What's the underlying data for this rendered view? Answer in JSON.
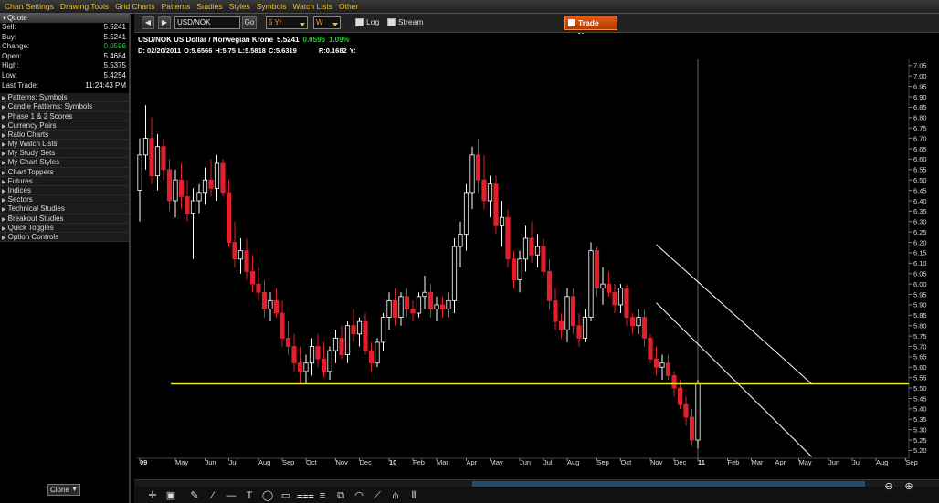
{
  "menubar": {
    "items": [
      "Chart Settings",
      "Drawing Tools",
      "Grid Charts",
      "Patterns",
      "Studies",
      "Styles",
      "Symbols",
      "Watch Lists",
      "Other"
    ]
  },
  "quote": {
    "header": "Quote",
    "rows": [
      {
        "label": "Sell:",
        "value": "5.5241"
      },
      {
        "label": "Buy:",
        "value": "5.5241"
      },
      {
        "label": "Change:",
        "value": "0.0596"
      },
      {
        "label": "Open:",
        "value": "5.4684"
      },
      {
        "label": "High:",
        "value": "5.5375"
      },
      {
        "label": "Low:",
        "value": "5.4254"
      },
      {
        "label": "Last Trade:",
        "value": "11:24:43 PM"
      }
    ]
  },
  "nav": {
    "items": [
      "Patterns: Symbols",
      "Candle Patterns: Symbols",
      "Phase 1 & 2 Scores",
      "Currency Pairs",
      "Ratio Charts",
      "My Watch Lists",
      "My Study Sets",
      "My Chart Styles",
      "Chart Toppers",
      "Futures",
      "Indices",
      "Sectors",
      "Technical Studies",
      "Breakout Studies",
      "Quick Toggles",
      "Option Controls"
    ]
  },
  "clone_label": "Clone",
  "toolbar": {
    "back": "◀",
    "forward": "▶",
    "symbol": "USD/NOK",
    "go": "Go",
    "period": "5 Yr",
    "interval": "W",
    "log_label": "Log",
    "stream_label": "Stream",
    "trade_now": "Trade Now"
  },
  "colors": {
    "up_candle": "#ffffff",
    "down_candle": "#e0202a",
    "support_line": "#e8e81a",
    "channel": "#ffffff",
    "positive": "#2ecc40"
  },
  "chart_data": {
    "type": "candlestick",
    "title": "USD/NOK US Dollar / Norwegian Krone",
    "last": "5.5241",
    "change": "0.0596",
    "change_pct": "1.09%",
    "ohlc_line": {
      "date": "D: 02/20/2011",
      "open": "O:5.6566",
      "high": "H:5.75",
      "low": "L:5.5818",
      "close": "C:5.6319",
      "r": "R:0.1682",
      "y": "Y:"
    },
    "ylim": [
      5.18,
      7.08
    ],
    "y_ticks": [
      "7.05",
      "7.00",
      "6.95",
      "6.90",
      "6.85",
      "6.80",
      "6.75",
      "6.70",
      "6.65",
      "6.60",
      "6.55",
      "6.50",
      "6.45",
      "6.40",
      "6.35",
      "6.30",
      "6.25",
      "6.20",
      "6.15",
      "6.10",
      "6.05",
      "6.00",
      "5.95",
      "5.90",
      "5.85",
      "5.80",
      "5.75",
      "5.70",
      "5.65",
      "5.60",
      "5.55",
      "5.50",
      "5.45",
      "5.40",
      "5.35",
      "5.30",
      "5.25",
      "5.20"
    ],
    "x_ticks": [
      {
        "label": "09",
        "i": 0,
        "bold": true
      },
      {
        "label": "May",
        "i": 6
      },
      {
        "label": "Jun",
        "i": 11
      },
      {
        "label": "Jul",
        "i": 15
      },
      {
        "label": "Aug",
        "i": 20
      },
      {
        "label": "Sep",
        "i": 24
      },
      {
        "label": "Oct",
        "i": 28
      },
      {
        "label": "Nov",
        "i": 33
      },
      {
        "label": "Dec",
        "i": 37
      },
      {
        "label": "10",
        "i": 42,
        "bold": true
      },
      {
        "label": "Feb",
        "i": 46
      },
      {
        "label": "Mar",
        "i": 50
      },
      {
        "label": "Apr",
        "i": 55
      },
      {
        "label": "May",
        "i": 59
      },
      {
        "label": "Jun",
        "i": 64
      },
      {
        "label": "Jul",
        "i": 68
      },
      {
        "label": "Aug",
        "i": 72
      },
      {
        "label": "Sep",
        "i": 77
      },
      {
        "label": "Oct",
        "i": 81
      },
      {
        "label": "Nov",
        "i": 86
      },
      {
        "label": "Dec",
        "i": 90
      },
      {
        "label": "11",
        "i": 94,
        "bold": true
      },
      {
        "label": "Feb",
        "i": 99
      },
      {
        "label": "Mar",
        "i": 103
      },
      {
        "label": "Apr",
        "i": 107
      },
      {
        "label": "May",
        "i": 111
      },
      {
        "label": "Jun",
        "i": 116
      },
      {
        "label": "Jul",
        "i": 120
      },
      {
        "label": "Aug",
        "i": 124
      },
      {
        "label": "Sep",
        "i": 129
      }
    ],
    "candles": [
      {
        "o": 6.45,
        "h": 6.7,
        "l": 6.3,
        "c": 6.62
      },
      {
        "o": 6.62,
        "h": 6.86,
        "l": 6.55,
        "c": 6.7
      },
      {
        "o": 6.7,
        "h": 6.8,
        "l": 6.48,
        "c": 6.52
      },
      {
        "o": 6.52,
        "h": 6.72,
        "l": 6.45,
        "c": 6.66
      },
      {
        "o": 6.66,
        "h": 6.7,
        "l": 6.5,
        "c": 6.55
      },
      {
        "o": 6.55,
        "h": 6.6,
        "l": 6.35,
        "c": 6.4
      },
      {
        "o": 6.4,
        "h": 6.55,
        "l": 6.32,
        "c": 6.5
      },
      {
        "o": 6.5,
        "h": 6.58,
        "l": 6.36,
        "c": 6.42
      },
      {
        "o": 6.42,
        "h": 6.5,
        "l": 6.3,
        "c": 6.34
      },
      {
        "o": 6.34,
        "h": 6.46,
        "l": 6.12,
        "c": 6.4
      },
      {
        "o": 6.4,
        "h": 6.48,
        "l": 6.34,
        "c": 6.44
      },
      {
        "o": 6.44,
        "h": 6.56,
        "l": 6.38,
        "c": 6.5
      },
      {
        "o": 6.5,
        "h": 6.6,
        "l": 6.42,
        "c": 6.46
      },
      {
        "o": 6.46,
        "h": 6.62,
        "l": 6.4,
        "c": 6.58
      },
      {
        "o": 6.58,
        "h": 6.6,
        "l": 6.42,
        "c": 6.44
      },
      {
        "o": 6.44,
        "h": 6.5,
        "l": 6.18,
        "c": 6.2
      },
      {
        "o": 6.2,
        "h": 6.3,
        "l": 6.08,
        "c": 6.12
      },
      {
        "o": 6.12,
        "h": 6.22,
        "l": 6.05,
        "c": 6.16
      },
      {
        "o": 6.16,
        "h": 6.22,
        "l": 6.02,
        "c": 6.06
      },
      {
        "o": 6.06,
        "h": 6.14,
        "l": 5.96,
        "c": 6.0
      },
      {
        "o": 6.0,
        "h": 6.08,
        "l": 5.92,
        "c": 5.96
      },
      {
        "o": 5.96,
        "h": 6.02,
        "l": 5.84,
        "c": 5.88
      },
      {
        "o": 5.88,
        "h": 5.96,
        "l": 5.82,
        "c": 5.92
      },
      {
        "o": 5.92,
        "h": 5.98,
        "l": 5.84,
        "c": 5.86
      },
      {
        "o": 5.86,
        "h": 5.92,
        "l": 5.7,
        "c": 5.74
      },
      {
        "o": 5.74,
        "h": 5.82,
        "l": 5.66,
        "c": 5.7
      },
      {
        "o": 5.7,
        "h": 5.76,
        "l": 5.58,
        "c": 5.62
      },
      {
        "o": 5.62,
        "h": 5.7,
        "l": 5.52,
        "c": 5.58
      },
      {
        "o": 5.58,
        "h": 5.66,
        "l": 5.52,
        "c": 5.62
      },
      {
        "o": 5.62,
        "h": 5.74,
        "l": 5.56,
        "c": 5.7
      },
      {
        "o": 5.7,
        "h": 5.76,
        "l": 5.6,
        "c": 5.64
      },
      {
        "o": 5.64,
        "h": 5.72,
        "l": 5.55,
        "c": 5.58
      },
      {
        "o": 5.58,
        "h": 5.7,
        "l": 5.54,
        "c": 5.68
      },
      {
        "o": 5.68,
        "h": 5.78,
        "l": 5.62,
        "c": 5.74
      },
      {
        "o": 5.74,
        "h": 5.8,
        "l": 5.64,
        "c": 5.66
      },
      {
        "o": 5.66,
        "h": 5.82,
        "l": 5.62,
        "c": 5.8
      },
      {
        "o": 5.8,
        "h": 5.88,
        "l": 5.72,
        "c": 5.76
      },
      {
        "o": 5.76,
        "h": 5.84,
        "l": 5.7,
        "c": 5.82
      },
      {
        "o": 5.82,
        "h": 5.86,
        "l": 5.66,
        "c": 5.68
      },
      {
        "o": 5.68,
        "h": 5.72,
        "l": 5.58,
        "c": 5.62
      },
      {
        "o": 5.62,
        "h": 5.74,
        "l": 5.6,
        "c": 5.72
      },
      {
        "o": 5.72,
        "h": 5.86,
        "l": 5.68,
        "c": 5.84
      },
      {
        "o": 5.84,
        "h": 5.96,
        "l": 5.78,
        "c": 5.92
      },
      {
        "o": 5.92,
        "h": 5.98,
        "l": 5.8,
        "c": 5.84
      },
      {
        "o": 5.84,
        "h": 5.96,
        "l": 5.8,
        "c": 5.94
      },
      {
        "o": 5.94,
        "h": 5.98,
        "l": 5.84,
        "c": 5.88
      },
      {
        "o": 5.88,
        "h": 5.92,
        "l": 5.82,
        "c": 5.86
      },
      {
        "o": 5.86,
        "h": 5.96,
        "l": 5.84,
        "c": 5.94
      },
      {
        "o": 5.94,
        "h": 6.04,
        "l": 5.88,
        "c": 5.96
      },
      {
        "o": 5.96,
        "h": 6.0,
        "l": 5.84,
        "c": 5.88
      },
      {
        "o": 5.88,
        "h": 5.94,
        "l": 5.82,
        "c": 5.9
      },
      {
        "o": 5.9,
        "h": 5.94,
        "l": 5.84,
        "c": 5.88
      },
      {
        "o": 5.88,
        "h": 5.96,
        "l": 5.84,
        "c": 5.92
      },
      {
        "o": 5.92,
        "h": 6.22,
        "l": 5.86,
        "c": 6.18
      },
      {
        "o": 6.18,
        "h": 6.3,
        "l": 6.08,
        "c": 6.24
      },
      {
        "o": 6.24,
        "h": 6.48,
        "l": 6.16,
        "c": 6.44
      },
      {
        "o": 6.44,
        "h": 6.66,
        "l": 6.36,
        "c": 6.62
      },
      {
        "o": 6.62,
        "h": 6.7,
        "l": 6.44,
        "c": 6.5
      },
      {
        "o": 6.5,
        "h": 6.62,
        "l": 6.36,
        "c": 6.4
      },
      {
        "o": 6.4,
        "h": 6.52,
        "l": 6.32,
        "c": 6.48
      },
      {
        "o": 6.48,
        "h": 6.52,
        "l": 6.24,
        "c": 6.28
      },
      {
        "o": 6.28,
        "h": 6.4,
        "l": 6.18,
        "c": 6.32
      },
      {
        "o": 6.32,
        "h": 6.36,
        "l": 6.08,
        "c": 6.12
      },
      {
        "o": 6.12,
        "h": 6.16,
        "l": 5.98,
        "c": 6.02
      },
      {
        "o": 6.02,
        "h": 6.16,
        "l": 5.96,
        "c": 6.12
      },
      {
        "o": 6.12,
        "h": 6.28,
        "l": 6.06,
        "c": 6.22
      },
      {
        "o": 6.22,
        "h": 6.3,
        "l": 6.1,
        "c": 6.14
      },
      {
        "o": 6.14,
        "h": 6.24,
        "l": 6.08,
        "c": 6.18
      },
      {
        "o": 6.18,
        "h": 6.22,
        "l": 6.04,
        "c": 6.06
      },
      {
        "o": 6.06,
        "h": 6.12,
        "l": 5.88,
        "c": 5.92
      },
      {
        "o": 5.92,
        "h": 5.98,
        "l": 5.78,
        "c": 5.82
      },
      {
        "o": 5.82,
        "h": 5.86,
        "l": 5.74,
        "c": 5.78
      },
      {
        "o": 5.78,
        "h": 5.98,
        "l": 5.72,
        "c": 5.94
      },
      {
        "o": 5.94,
        "h": 5.98,
        "l": 5.76,
        "c": 5.8
      },
      {
        "o": 5.8,
        "h": 5.86,
        "l": 5.7,
        "c": 5.74
      },
      {
        "o": 5.74,
        "h": 5.88,
        "l": 5.72,
        "c": 5.84
      },
      {
        "o": 5.84,
        "h": 6.2,
        "l": 5.82,
        "c": 6.16
      },
      {
        "o": 6.16,
        "h": 6.18,
        "l": 5.94,
        "c": 5.98
      },
      {
        "o": 5.98,
        "h": 6.08,
        "l": 5.9,
        "c": 6.0
      },
      {
        "o": 6.0,
        "h": 6.06,
        "l": 5.94,
        "c": 5.96
      },
      {
        "o": 5.96,
        "h": 6.0,
        "l": 5.86,
        "c": 5.9
      },
      {
        "o": 5.9,
        "h": 6.0,
        "l": 5.86,
        "c": 5.98
      },
      {
        "o": 5.98,
        "h": 6.0,
        "l": 5.8,
        "c": 5.84
      },
      {
        "o": 5.84,
        "h": 5.86,
        "l": 5.76,
        "c": 5.8
      },
      {
        "o": 5.8,
        "h": 5.88,
        "l": 5.76,
        "c": 5.84
      },
      {
        "o": 5.84,
        "h": 5.88,
        "l": 5.7,
        "c": 5.74
      },
      {
        "o": 5.74,
        "h": 5.76,
        "l": 5.62,
        "c": 5.64
      },
      {
        "o": 5.64,
        "h": 5.7,
        "l": 5.56,
        "c": 5.6
      },
      {
        "o": 5.6,
        "h": 5.66,
        "l": 5.54,
        "c": 5.62
      },
      {
        "o": 5.62,
        "h": 5.66,
        "l": 5.54,
        "c": 5.56
      },
      {
        "o": 5.56,
        "h": 5.58,
        "l": 5.46,
        "c": 5.5
      },
      {
        "o": 5.5,
        "h": 5.54,
        "l": 5.4,
        "c": 5.42
      },
      {
        "o": 5.42,
        "h": 5.46,
        "l": 5.32,
        "c": 5.36
      },
      {
        "o": 5.36,
        "h": 5.4,
        "l": 5.22,
        "c": 5.25
      },
      {
        "o": 5.25,
        "h": 5.54,
        "l": 5.21,
        "c": 5.52
      }
    ],
    "support_line_value": 5.52,
    "cursor_candle": 94
  },
  "drawbar": {
    "tools": [
      "pointer-tool",
      "crosshair-tool",
      "pen-tool",
      "ray-tool",
      "hline-tool",
      "text-tool",
      "ellipse-tool",
      "rect-tool",
      "fib-tool",
      "channel-tool",
      "gann-tool",
      "arc-tool",
      "trend-tool",
      "pitchfork-tool",
      "cycle-tool"
    ]
  }
}
